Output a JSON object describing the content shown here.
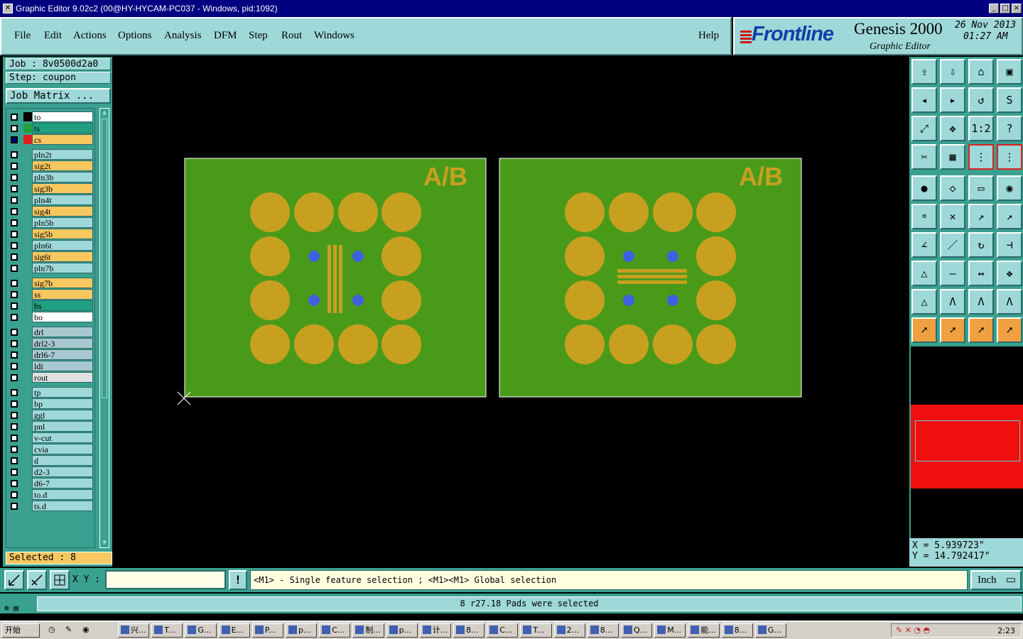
{
  "window": {
    "title": "Graphic Editor 9.02c2 (00@HY-HYCAM-PC037 - Windows, pid:1092)"
  },
  "menu": {
    "items": [
      "File",
      "Edit",
      "Actions",
      "Options",
      "Analysis",
      "DFM",
      "Step",
      "Rout",
      "Windows"
    ],
    "help": "Help"
  },
  "brand": {
    "logo": "Frontline",
    "product": "Genesis 2000",
    "subtitle": "Graphic Editor",
    "date": "26 Nov 2013",
    "time": "01:27 AM"
  },
  "job": {
    "job_label": "Job : 8v0500d2a0",
    "step_label": "Step: coupon",
    "matrix_button": "Job Matrix ..."
  },
  "layers": [
    {
      "name": "to",
      "color": "#ffffff",
      "swatch": "#000000"
    },
    {
      "name": "ts",
      "color": "#20a080",
      "swatch": "#20a040"
    },
    {
      "name": "cs",
      "color": "#f8c860",
      "swatch": "#e02020",
      "active": true
    },
    {
      "name": "pln2t",
      "color": "#9fd8d8"
    },
    {
      "name": "sig2t",
      "color": "#f8c860"
    },
    {
      "name": "pln3b",
      "color": "#9fd8d8"
    },
    {
      "name": "sig3b",
      "color": "#f8c860"
    },
    {
      "name": "pln4t",
      "color": "#9fd8d8"
    },
    {
      "name": "sig4t",
      "color": "#f8c860"
    },
    {
      "name": "pln5b",
      "color": "#9fd8d8"
    },
    {
      "name": "sig5b",
      "color": "#f8c860"
    },
    {
      "name": "pln6t",
      "color": "#9fd8d8"
    },
    {
      "name": "sig6t",
      "color": "#f8c860"
    },
    {
      "name": "pln7b",
      "color": "#9fd8d8"
    },
    {
      "name": "sig7b",
      "color": "#f8c860"
    },
    {
      "name": "ss",
      "color": "#f8c860"
    },
    {
      "name": "bs",
      "color": "#20a080"
    },
    {
      "name": "bo",
      "color": "#ffffff"
    },
    {
      "name": "drl",
      "color": "#a8c8d0"
    },
    {
      "name": "drl2-3",
      "color": "#a8c8d0"
    },
    {
      "name": "drl6-7",
      "color": "#a8c8d0"
    },
    {
      "name": "ldi",
      "color": "#a8c8d0"
    },
    {
      "name": "rout",
      "color": "#e0e0e0"
    },
    {
      "name": "tp",
      "color": "#9fd8d8"
    },
    {
      "name": "bp",
      "color": "#9fd8d8"
    },
    {
      "name": "ggl",
      "color": "#9fd8d8"
    },
    {
      "name": "pnl",
      "color": "#9fd8d8"
    },
    {
      "name": "v-cut",
      "color": "#9fd8d8"
    },
    {
      "name": "cvia",
      "color": "#9fd8d8"
    },
    {
      "name": "d",
      "color": "#9fd8d8"
    },
    {
      "name": "d2-3",
      "color": "#9fd8d8"
    },
    {
      "name": "d6-7",
      "color": "#9fd8d8"
    },
    {
      "name": "to.d",
      "color": "#9fd8d8"
    },
    {
      "name": "ts.d",
      "color": "#9fd8d8"
    }
  ],
  "selected_label": "Selected : 8",
  "board": {
    "marker_left": "A/B",
    "marker_right": "A/B",
    "board_color": "#4a9a1a",
    "pad_color": "#c8a020",
    "via_color": "#4060e0"
  },
  "coords": {
    "x": "X = 5.939723\"",
    "y": "Y = 14.792417\""
  },
  "cmd": {
    "xy_label": "X Y :",
    "xy_value": "",
    "hint": "<M1> - Single feature selection ; <M1><M1> Global selection",
    "units": "Inch"
  },
  "status": "8 r27.18 Pads were selected",
  "taskbar": {
    "start": "开始",
    "tasks": [
      "兴...",
      "T...",
      "G...",
      "E...",
      "P...",
      "p...",
      "C...",
      "制...",
      "p...",
      "计...",
      "8...",
      "C...",
      "T...",
      "2...",
      "8...",
      "Q...",
      "M...",
      "能...",
      "8...",
      "G..."
    ],
    "clock": "2:23"
  }
}
